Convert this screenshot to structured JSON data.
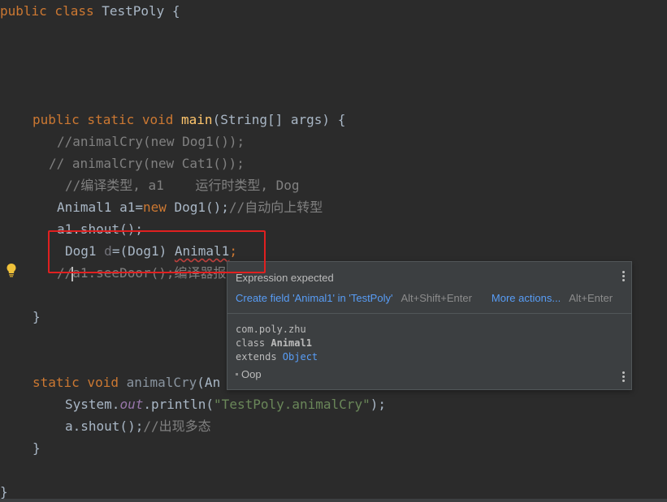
{
  "editor": {
    "lines": {
      "l1": {
        "kw": "public class ",
        "name": "TestPoly",
        "rest": " {"
      },
      "l2": {
        "kw1": "public static void ",
        "fn": "main",
        "rest": "(String[] args) {"
      },
      "l3": "//animalCry(new Dog1());",
      "l4": "// animalCry(new Cat1());",
      "l5": "//编译类型, a1    运行时类型, Dog",
      "l6": {
        "a": "Animal1 a1=",
        "kw": "new",
        "b": " Dog1();",
        "cm": "//自动向上转型"
      },
      "l7": "a1.shout();",
      "l8": {
        "a": "Dog1 ",
        "d": "d",
        "b": "=(Dog1) ",
        "err": "Animal1",
        "semi": ";"
      },
      "l9": {
        "a": "//",
        "b": "a1.seeDoor();编译器报"
      },
      "l10": "}",
      "l11": {
        "kw": "static void ",
        "fn": "animalCry",
        "rest": "(An"
      },
      "l12": {
        "a": "System.",
        "st": "out",
        "b": ".println(",
        "str": "\"TestPoly.animalCry\"",
        "c": ");"
      },
      "l13": {
        "a": "a.shout();",
        "cm": "//出现多态"
      },
      "l14": "}",
      "l15": "}"
    }
  },
  "popup": {
    "title": "Expression expected",
    "action_create": "Create field 'Animal1' in 'TestPoly'",
    "action_create_shortcut": "Alt+Shift+Enter",
    "action_more": "More actions...",
    "action_more_shortcut": "Alt+Enter",
    "doc_package": "com.poly.zhu",
    "doc_class_kw": "class ",
    "doc_class_name": "Animal1",
    "doc_extends_kw": "extends ",
    "doc_extends_name": "Object",
    "module": "Oop"
  },
  "icons": {
    "bulb": "lightbulb-icon",
    "menu": "more-vertical-icon"
  },
  "colors": {
    "background": "#2b2b2b",
    "keyword": "#cc7832",
    "function": "#ffc66d",
    "comment": "#808080",
    "string": "#6a8759",
    "link": "#589df6",
    "highlight_box": "#e02020"
  }
}
